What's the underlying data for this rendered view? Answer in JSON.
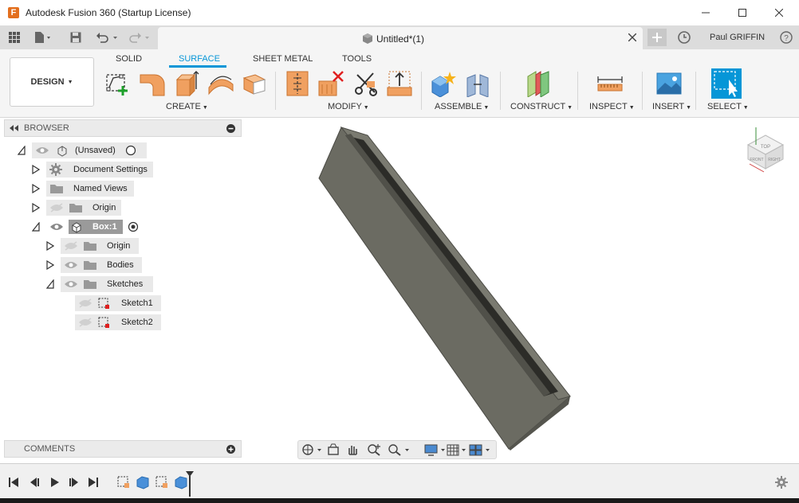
{
  "window": {
    "title": "Autodesk Fusion 360 (Startup License)",
    "app_icon_letter": "F"
  },
  "tabbar": {
    "document_title": "Untitled*(1)",
    "user_name": "Paul GRIFFIN"
  },
  "toolbar": {
    "workspace_label": "DESIGN",
    "tabs": [
      "SOLID",
      "SURFACE",
      "SHEET METAL",
      "TOOLS"
    ],
    "active_tab": "SURFACE",
    "groups": [
      "CREATE",
      "MODIFY",
      "ASSEMBLE",
      "CONSTRUCT",
      "INSPECT",
      "INSERT",
      "SELECT"
    ]
  },
  "browser": {
    "title": "BROWSER",
    "items": [
      {
        "label": "(Unsaved)"
      },
      {
        "label": "Document Settings"
      },
      {
        "label": "Named Views"
      },
      {
        "label": "Origin"
      },
      {
        "label": "Box:1"
      },
      {
        "label": "Origin"
      },
      {
        "label": "Bodies"
      },
      {
        "label": "Sketches"
      },
      {
        "label": "Sketch1"
      },
      {
        "label": "Sketch2"
      }
    ]
  },
  "comments": {
    "title": "COMMENTS"
  },
  "viewcube": {
    "labels": [
      "TOP",
      "FRONT",
      "RIGHT"
    ]
  },
  "colors": {
    "accent": "#0696d7",
    "body_gray": "#6b6b62",
    "panel_bg": "#f5f5f5"
  }
}
